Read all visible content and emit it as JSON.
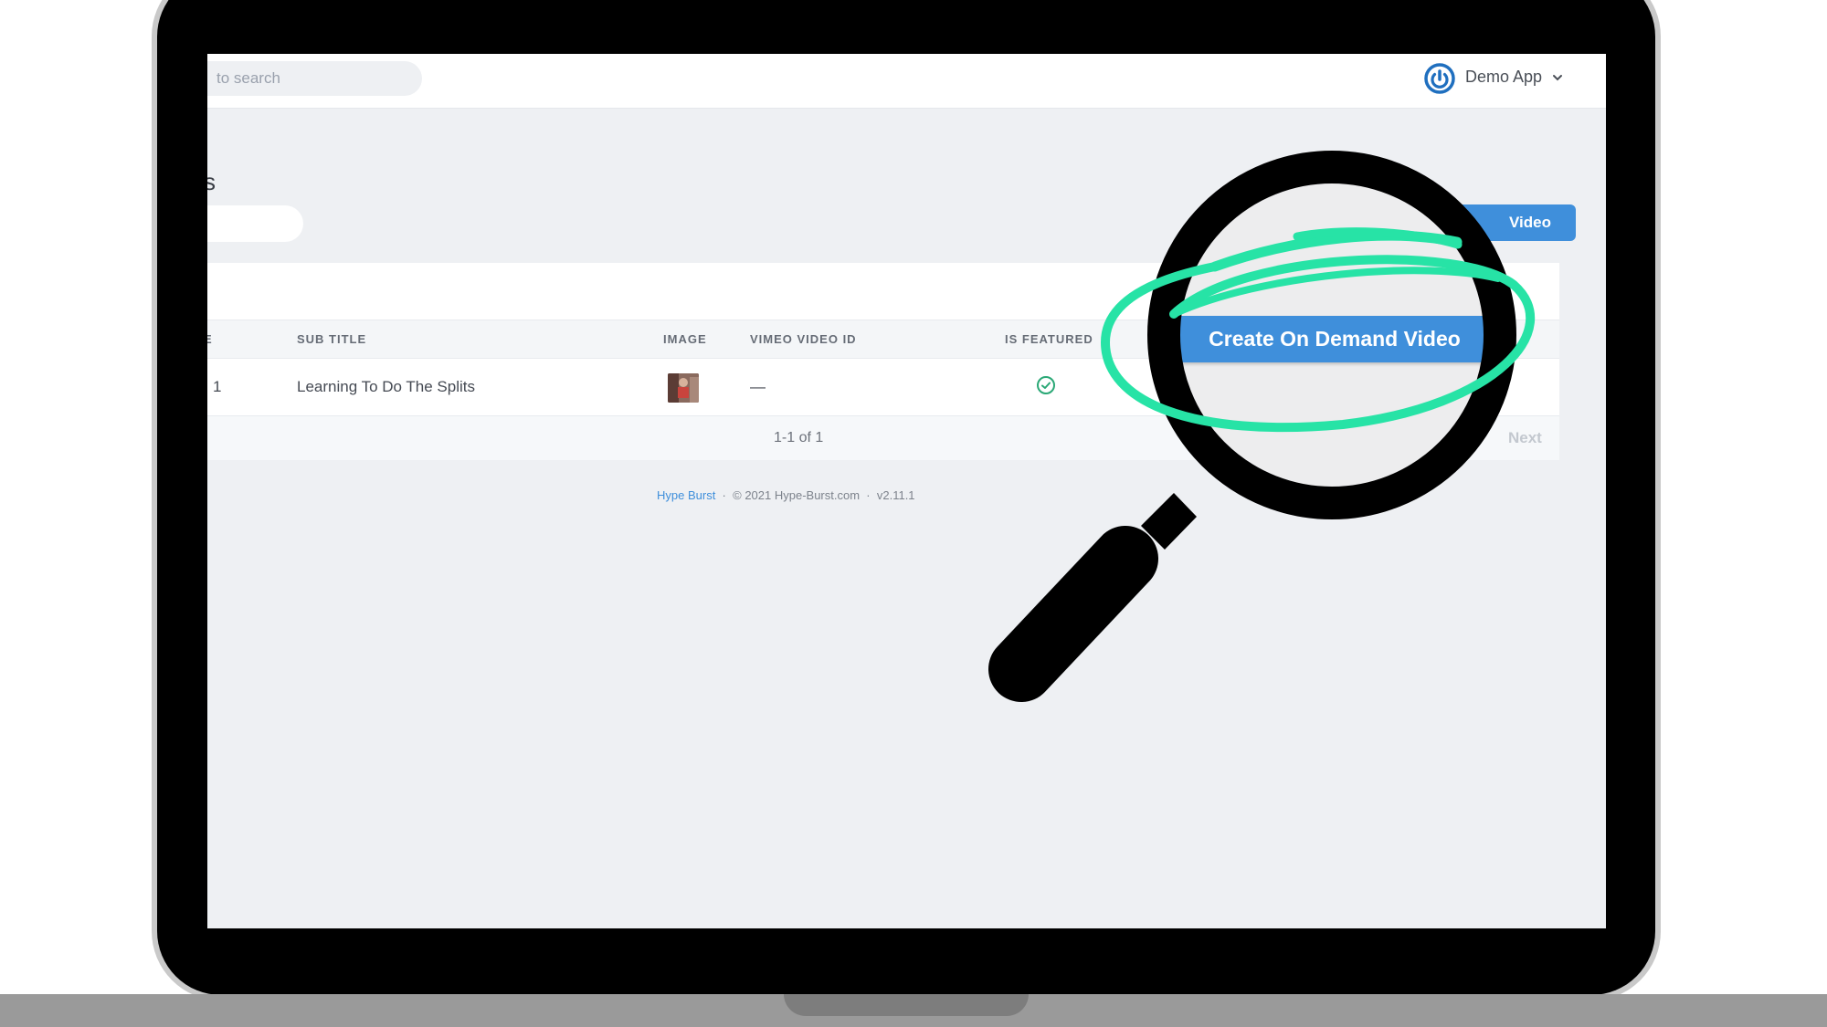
{
  "header": {
    "search_placeholder": "to search",
    "app_name": "Demo App"
  },
  "page": {
    "title": "s"
  },
  "toolbar": {
    "create_button_label": "Video"
  },
  "table": {
    "columns": [
      "E",
      "SUB TITLE",
      "IMAGE",
      "VIMEO VIDEO ID",
      "IS FEATURED"
    ],
    "rows": [
      {
        "title": "1",
        "sub_title": "Learning To Do The Splits",
        "vimeo_video_id": "—",
        "is_featured": true
      }
    ],
    "pagination": "1-1 of 1",
    "next_label": "Next"
  },
  "footer": {
    "brand": "Hype Burst",
    "copyright": "© 2021 Hype-Burst.com",
    "version": "v2.11.1"
  },
  "zoom_callout": {
    "button_label": "Create On Demand Video"
  },
  "colors": {
    "accent": "#3f8fdb",
    "highlight": "#27e3a6",
    "featured": "#2aa876"
  }
}
